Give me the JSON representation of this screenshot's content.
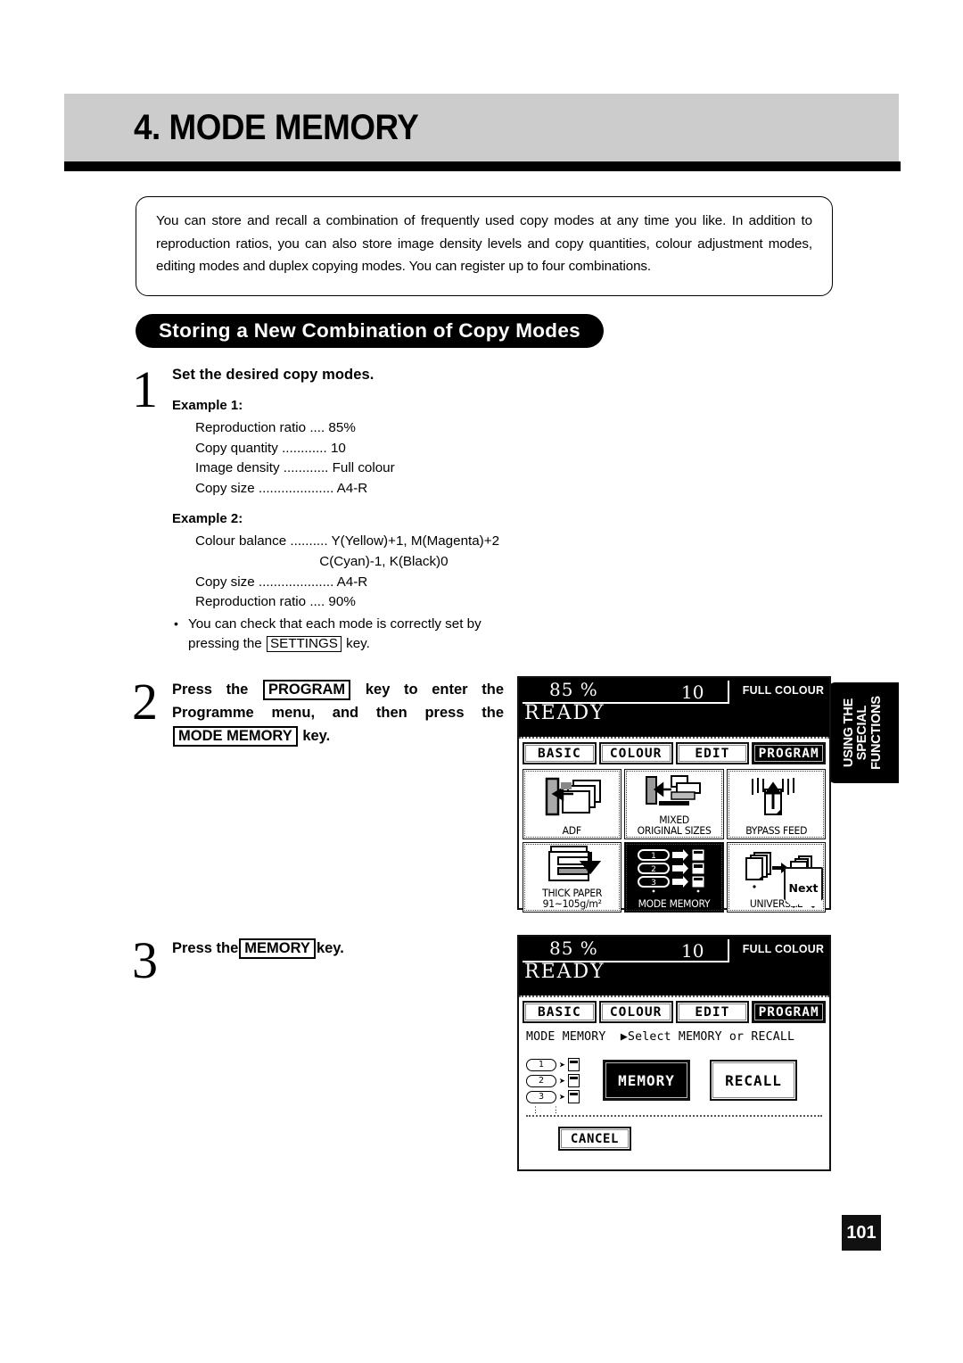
{
  "chapter": {
    "title": "4. MODE MEMORY"
  },
  "intro": {
    "text": "You can store and recall a combination of frequently used copy modes at any time you like. In addition to reproduction ratios, you can also store image density levels and copy quantities, colour adjustment modes, editing modes and duplex copying modes. You can register up to four combinations."
  },
  "section": {
    "title": "Storing a New Combination of Copy Modes"
  },
  "steps": {
    "step1": {
      "number": "1",
      "heading": "Set the desired copy modes.",
      "example1_label": "Example 1:",
      "example1_lines": [
        "Reproduction ratio .... 85%",
        "Copy quantity ............ 10",
        "Image density ............ Full colour",
        "Copy size .................... A4-R"
      ],
      "example2_label": "Example 2:",
      "example2_lines": [
        "Colour balance .......... Y(Yellow)+1, M(Magenta)+2",
        "                                 C(Cyan)-1, K(Black)0",
        "Copy size .................... A4-R",
        "Reproduction ratio .... 90%"
      ],
      "note_pre": "You can check that each mode is correctly set by pressing the ",
      "note_key": "SETTINGS",
      "note_post": " key."
    },
    "step2": {
      "number": "2",
      "text_a": "Press the ",
      "key_a": "PROGRAM",
      "text_b": " key to enter the Programme menu, and then press the ",
      "key_b": "MODE MEMORY",
      "text_c": " key."
    },
    "step3": {
      "number": "3",
      "text_a": "Press the",
      "key_a": "MEMORY",
      "text_b": "key."
    }
  },
  "side_tab": {
    "label": "USING THE\nSPECIAL\nFUNCTIONS"
  },
  "page_number": "101",
  "lcd1": {
    "ratio": "85 %",
    "quantity": "10",
    "colour_mode": "FULL COLOUR",
    "status": "READY",
    "tabs": [
      {
        "label": "BASIC",
        "selected": false
      },
      {
        "label": "COLOUR",
        "selected": false
      },
      {
        "label": "EDIT",
        "selected": false
      },
      {
        "label": "PROGRAM",
        "selected": true
      }
    ],
    "cells": [
      {
        "label": "ADF",
        "icon": "adf-icon",
        "selected": false
      },
      {
        "label": "MIXED\nORIGINAL SIZES",
        "icon": "mixed-original-sizes-icon",
        "selected": false
      },
      {
        "label": "BYPASS FEED",
        "icon": "bypass-feed-icon",
        "selected": false
      },
      {
        "label": "THICK PAPER\n91~105g/m²",
        "icon": "thick-paper-icon",
        "selected": false
      },
      {
        "label": "MODE MEMORY",
        "icon": "mode-memory-icon",
        "selected": true
      },
      {
        "label": "UNIVERSAL",
        "icon": "universal-icon",
        "selected": false
      }
    ],
    "next_label": "Next"
  },
  "lcd2": {
    "ratio": "85 %",
    "quantity": "10",
    "colour_mode": "FULL COLOUR",
    "status": "READY",
    "tabs": [
      {
        "label": "BASIC",
        "selected": false
      },
      {
        "label": "COLOUR",
        "selected": false
      },
      {
        "label": "EDIT",
        "selected": false
      },
      {
        "label": "PROGRAM",
        "selected": true
      }
    ],
    "message": "MODE MEMORY  ▶Select MEMORY or RECALL",
    "memory_slots": [
      "1",
      "2",
      "3"
    ],
    "memory_button": "MEMORY",
    "recall_button": "RECALL",
    "cancel_button": "CANCEL"
  },
  "colors": {
    "header_band": "#cccccc",
    "rule": "#000000",
    "pill": "#000000"
  }
}
